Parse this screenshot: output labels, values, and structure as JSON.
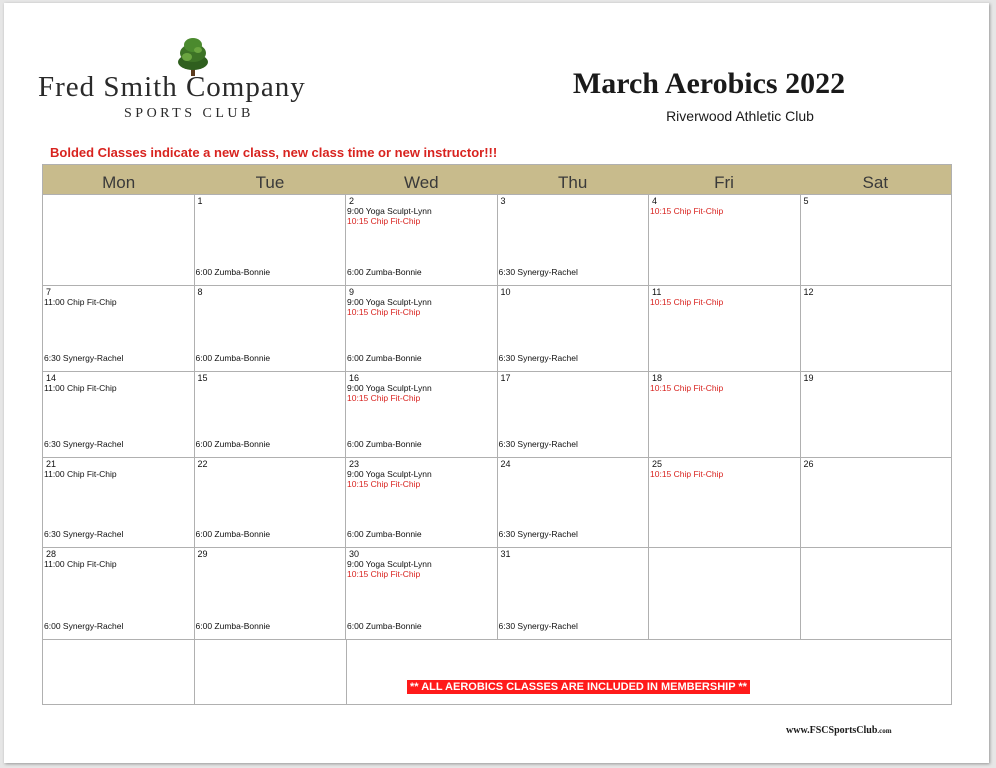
{
  "header": {
    "logo_main": "Fred Smith Company",
    "logo_sub": "SPORTS CLUB",
    "title": "March Aerobics 2022",
    "subtitle": "Riverwood Athletic Club",
    "notice": "Bolded Classes indicate a new class, new class time or new instructor!!!"
  },
  "colors": {
    "header_band": "#c8bb8c",
    "notice_red": "#d8231f",
    "banner_red": "#ff1a1a"
  },
  "calendar": {
    "days": [
      "Mon",
      "Tue",
      "Wed",
      "Thu",
      "Fri",
      "Sat"
    ],
    "weeks": [
      [
        {
          "date": "",
          "top": [],
          "bottom": ""
        },
        {
          "date": "1",
          "top": [],
          "bottom": "6:00 Zumba-Bonnie"
        },
        {
          "date": "2",
          "top": [
            {
              "text": "9:00 Yoga Sculpt-Lynn",
              "red": false
            },
            {
              "text": "10:15 Chip Fit-Chip",
              "red": true
            }
          ],
          "bottom": "6:00 Zumba-Bonnie"
        },
        {
          "date": "3",
          "top": [],
          "bottom": "6:30 Synergy-Rachel"
        },
        {
          "date": "4",
          "top": [
            {
              "text": "10:15 Chip Fit-Chip",
              "red": true
            }
          ],
          "bottom": ""
        },
        {
          "date": "5",
          "top": [],
          "bottom": ""
        }
      ],
      [
        {
          "date": "7",
          "top": [
            {
              "text": "11:00 Chip Fit-Chip",
              "red": false
            }
          ],
          "bottom": "6:30 Synergy-Rachel"
        },
        {
          "date": "8",
          "top": [],
          "bottom": "6:00 Zumba-Bonnie"
        },
        {
          "date": "9",
          "top": [
            {
              "text": "9:00 Yoga Sculpt-Lynn",
              "red": false
            },
            {
              "text": "10:15 Chip Fit-Chip",
              "red": true
            }
          ],
          "bottom": "6:00 Zumba-Bonnie"
        },
        {
          "date": "10",
          "top": [],
          "bottom": "6:30 Synergy-Rachel"
        },
        {
          "date": "11",
          "top": [
            {
              "text": "10:15 Chip Fit-Chip",
              "red": true
            }
          ],
          "bottom": ""
        },
        {
          "date": "12",
          "top": [],
          "bottom": ""
        }
      ],
      [
        {
          "date": "14",
          "top": [
            {
              "text": "11:00 Chip Fit-Chip",
              "red": false
            }
          ],
          "bottom": "6:30 Synergy-Rachel"
        },
        {
          "date": "15",
          "top": [],
          "bottom": "6:00 Zumba-Bonnie"
        },
        {
          "date": "16",
          "top": [
            {
              "text": "9:00 Yoga Sculpt-Lynn",
              "red": false
            },
            {
              "text": "10:15 Chip Fit-Chip",
              "red": true
            }
          ],
          "bottom": "6:00 Zumba-Bonnie"
        },
        {
          "date": "17",
          "top": [],
          "bottom": "6:30 Synergy-Rachel"
        },
        {
          "date": "18",
          "top": [
            {
              "text": "10:15 Chip Fit-Chip",
              "red": true
            }
          ],
          "bottom": ""
        },
        {
          "date": "19",
          "top": [],
          "bottom": ""
        }
      ],
      [
        {
          "date": "21",
          "top": [
            {
              "text": "11:00 Chip Fit-Chip",
              "red": false
            }
          ],
          "bottom": "6:30 Synergy-Rachel"
        },
        {
          "date": "22",
          "top": [],
          "bottom": "6:00 Zumba-Bonnie"
        },
        {
          "date": "23",
          "top": [
            {
              "text": "9:00 Yoga Sculpt-Lynn",
              "red": false
            },
            {
              "text": "10:15 Chip Fit-Chip",
              "red": true
            }
          ],
          "bottom": "6:00 Zumba-Bonnie"
        },
        {
          "date": "24",
          "top": [],
          "bottom": "6:30 Synergy-Rachel"
        },
        {
          "date": "25",
          "top": [
            {
              "text": "10:15 Chip Fit-Chip",
              "red": true
            }
          ],
          "bottom": ""
        },
        {
          "date": "26",
          "top": [],
          "bottom": ""
        }
      ],
      [
        {
          "date": "28",
          "top": [
            {
              "text": "11:00 Chip Fit-Chip",
              "red": false
            }
          ],
          "bottom": "6:00 Synergy-Rachel"
        },
        {
          "date": "29",
          "top": [],
          "bottom": "6:00 Zumba-Bonnie"
        },
        {
          "date": "30",
          "top": [
            {
              "text": "9:00 Yoga Sculpt-Lynn",
              "red": false
            },
            {
              "text": "10:15 Chip Fit-Chip",
              "red": true
            }
          ],
          "bottom": "6:00 Zumba-Bonnie"
        },
        {
          "date": "31",
          "top": [],
          "bottom": "6:30 Synergy-Rachel"
        },
        {
          "date": "",
          "top": [],
          "bottom": ""
        },
        {
          "date": "",
          "top": [],
          "bottom": ""
        }
      ]
    ],
    "banner": "** ALL AEROBICS CLASSES ARE INCLUDED IN MEMBERSHIP **"
  },
  "footer": {
    "url_main": "www.FSCSportsClub",
    "url_tld": ".com"
  }
}
